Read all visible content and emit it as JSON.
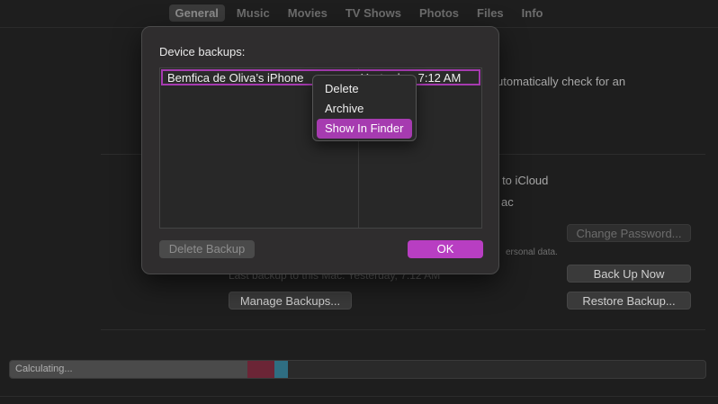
{
  "tabs": [
    {
      "label": "General",
      "active": true
    },
    {
      "label": "Music",
      "active": false
    },
    {
      "label": "Movies",
      "active": false
    },
    {
      "label": "TV Shows",
      "active": false
    },
    {
      "label": "Photos",
      "active": false
    },
    {
      "label": "Files",
      "active": false
    },
    {
      "label": "Info",
      "active": false
    }
  ],
  "background": {
    "auto_check_text": "utomatically check for an",
    "icloud_text": "ne to iCloud",
    "mac_text": "ac",
    "personal_data_text": "ersonal data.",
    "last_backup_text": "Last backup to this Mac: Yesterday, 7:12 AM",
    "change_password_label": "Change Password...",
    "back_up_now_label": "Back Up Now",
    "manage_backups_label": "Manage Backups...",
    "restore_backup_label": "Restore Backup..."
  },
  "storage": {
    "label": "Calculating...",
    "segments": [
      {
        "color": "#4a4a4a",
        "fraction": 0.342
      },
      {
        "color": "#6b2536",
        "fraction": 0.038
      },
      {
        "color": "#2f6e82",
        "fraction": 0.02
      }
    ]
  },
  "dialog": {
    "title": "Device backups:",
    "backups": [
      {
        "name": "Bemfica de Oliva’s iPhone",
        "date": "Yesterday, 7:12 AM",
        "selected": true
      }
    ],
    "delete_label": "Delete Backup",
    "ok_label": "OK"
  },
  "context_menu": {
    "items": [
      {
        "label": "Delete",
        "highlighted": false
      },
      {
        "label": "Archive",
        "highlighted": false
      },
      {
        "label": "Show In Finder",
        "highlighted": true
      }
    ]
  },
  "colors": {
    "accent": "#b83ec2",
    "selection": "#a63bb0"
  }
}
